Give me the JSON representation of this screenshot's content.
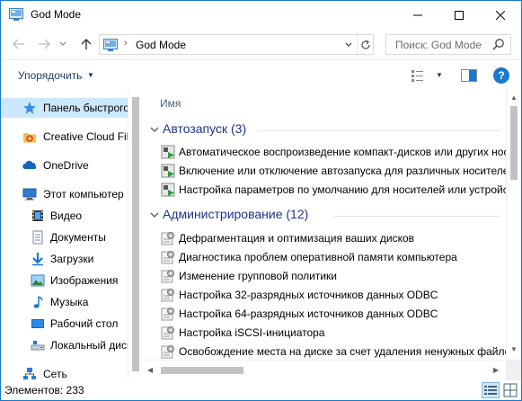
{
  "window": {
    "title": "God Mode",
    "icons": {
      "app": "control-panel-icon",
      "minimize": "minimize-icon",
      "maximize": "maximize-icon",
      "close": "close-icon"
    }
  },
  "navigation": {
    "back_icon": "arrow-left-icon",
    "forward_icon": "arrow-right-icon",
    "recent_icon": "chevron-down-icon",
    "up_icon": "arrow-up-icon",
    "address_path": "God Mode",
    "address_separator": "›",
    "search_placeholder": "Поиск: God Mode"
  },
  "commandbar": {
    "organize_label": "Упорядочить",
    "view_icon": "change-view-icon",
    "preview_icon": "preview-pane-icon",
    "help_label": "?"
  },
  "navpane": {
    "items": [
      {
        "label": "Панель быстрого доступа",
        "icon": "star-icon",
        "selected": true
      },
      {
        "label": "Creative Cloud Files",
        "icon": "creative-cloud-folder-icon"
      },
      {
        "label": "OneDrive",
        "icon": "onedrive-cloud-icon"
      },
      {
        "label": "Этот компьютер",
        "icon": "computer-icon"
      },
      {
        "label": "Видео",
        "icon": "video-folder-icon"
      },
      {
        "label": "Документы",
        "icon": "documents-folder-icon"
      },
      {
        "label": "Загрузки",
        "icon": "downloads-folder-icon"
      },
      {
        "label": "Изображения",
        "icon": "pictures-folder-icon"
      },
      {
        "label": "Музыка",
        "icon": "music-folder-icon"
      },
      {
        "label": "Рабочий стол",
        "icon": "desktop-folder-icon"
      },
      {
        "label": "Локальный диск (C:)",
        "icon": "local-disk-icon"
      },
      {
        "label": "Сеть",
        "icon": "network-icon"
      }
    ]
  },
  "filelist": {
    "column_name": "Имя",
    "groups": [
      {
        "title": "Автозапуск (3)",
        "items": [
          "Автоматическое воспроизведение компакт-дисков или других носителей",
          "Включение или отключение автозапуска для различных носителей",
          "Настройка параметров по умолчанию для носителей или устройств"
        ]
      },
      {
        "title": "Администрирование (12)",
        "items": [
          "Дефрагментация и оптимизация ваших дисков",
          "Диагностика проблем оперативной памяти компьютера",
          "Изменение групповой политики",
          "Настройка 32-разрядных источников данных ODBC",
          "Настройка 64-разрядных источников данных ODBC",
          "Настройка iSCSI-инициатора",
          "Освобождение места на диске за счет удаления ненужных файлов"
        ]
      }
    ]
  },
  "statusbar": {
    "items_count": "Элементов: 233"
  },
  "colors": {
    "accent": "#1979ca",
    "selection": "#cce8ff",
    "group_header": "#1e3287"
  }
}
